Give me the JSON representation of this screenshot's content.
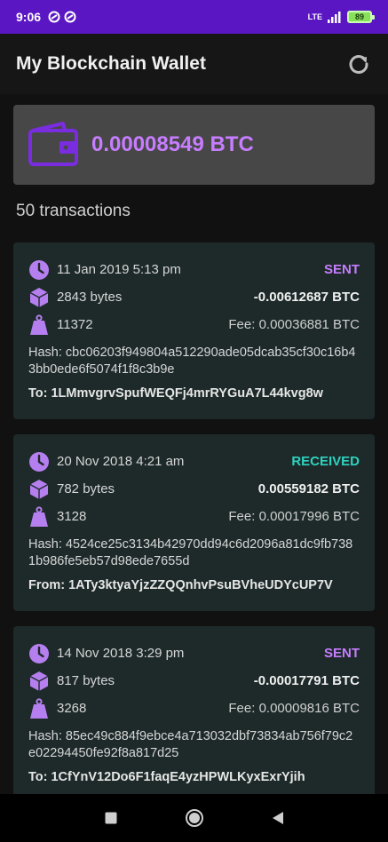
{
  "status_bar": {
    "time": "9:06",
    "network": "LTE",
    "battery": "89"
  },
  "app": {
    "title": "My Blockchain Wallet"
  },
  "balance": {
    "amount": "0.00008549 BTC"
  },
  "colors": {
    "accent": "#c77dff",
    "sent": "#c77dff",
    "received": "#2ed3c0",
    "status_bar": "#5b16c4"
  },
  "transactions_count": "50 transactions",
  "transactions": [
    {
      "date": "11 Jan 2019 5:13 pm",
      "direction": "SENT",
      "size": "2843 bytes",
      "amount": "-0.00612687 BTC",
      "weight": "11372",
      "fee": "Fee: 0.00036881 BTC",
      "hash": "Hash: cbc06203f949804a512290ade05dcab35cf30c16b43bb0ede6f5074f1f8c3b9e",
      "address": "To: 1LMmvgrvSpufWEQFj4mrRYGuA7L44kvg8w"
    },
    {
      "date": "20 Nov 2018 4:21 am",
      "direction": "RECEIVED",
      "size": "782 bytes",
      "amount": "0.00559182 BTC",
      "weight": "3128",
      "fee": "Fee: 0.00017996 BTC",
      "hash": "Hash: 4524ce25c3134b42970dd94c6d2096a81dc9fb7381b986fe5eb57d98ede7655d",
      "address": "From: 1ATy3ktyaYjzZZQQnhvPsuBVheUDYcUP7V"
    },
    {
      "date": "14 Nov 2018 3:29 pm",
      "direction": "SENT",
      "size": "817 bytes",
      "amount": "-0.00017791 BTC",
      "weight": "3268",
      "fee": "Fee: 0.00009816 BTC",
      "hash": "Hash: 85ec49c884f9ebce4a713032dbf73834ab756f79c2e02294450fe92f8a817d25",
      "address": "To: 1CfYnV12Do6F1faqE4yzHPWLKyxExrYjih"
    }
  ]
}
